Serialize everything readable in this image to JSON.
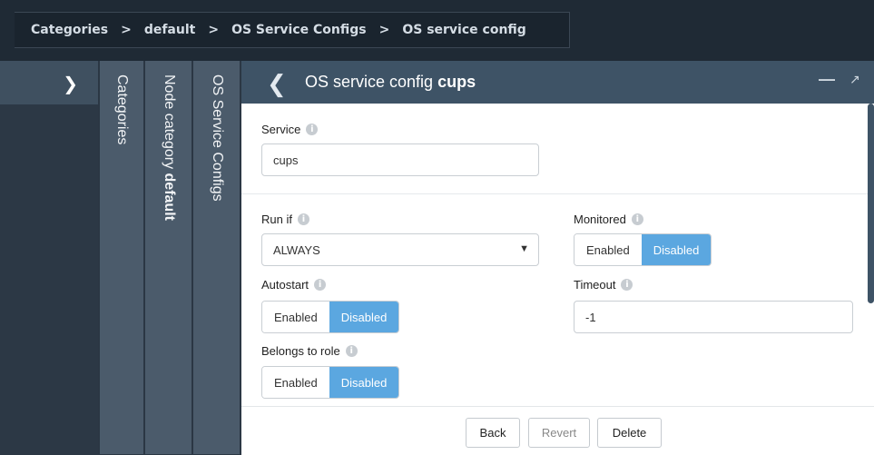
{
  "breadcrumb": [
    "Categories",
    "default",
    "OS Service Configs",
    "OS service config"
  ],
  "breadcrumb_separator": ">",
  "vertical_tabs": {
    "categories": "Categories",
    "node_category_prefix": "Node category",
    "node_category_name": "default",
    "os_service_configs": "OS Service Configs"
  },
  "panel": {
    "title_prefix": "OS service config",
    "title_name": "cups"
  },
  "form": {
    "service_label": "Service",
    "service_value": "cups",
    "run_if_label": "Run if",
    "run_if_value": "ALWAYS",
    "monitored_label": "Monitored",
    "autostart_label": "Autostart",
    "timeout_label": "Timeout",
    "timeout_value": "-1",
    "belongs_label": "Belongs to role",
    "enabled": "Enabled",
    "disabled": "Disabled"
  },
  "toggles": {
    "monitored": "Disabled",
    "autostart": "Disabled",
    "belongs_to_role": "Disabled"
  },
  "buttons": {
    "back": "Back",
    "revert": "Revert",
    "delete": "Delete"
  },
  "colors": {
    "accent": "#5ba7e0",
    "header": "#3e5366",
    "background": "#2b3744"
  },
  "icons": [
    "chevron-right-icon",
    "chevron-left-icon",
    "minimize-icon",
    "maximize-icon",
    "info-icon",
    "dropdown-arrow-icon"
  ]
}
